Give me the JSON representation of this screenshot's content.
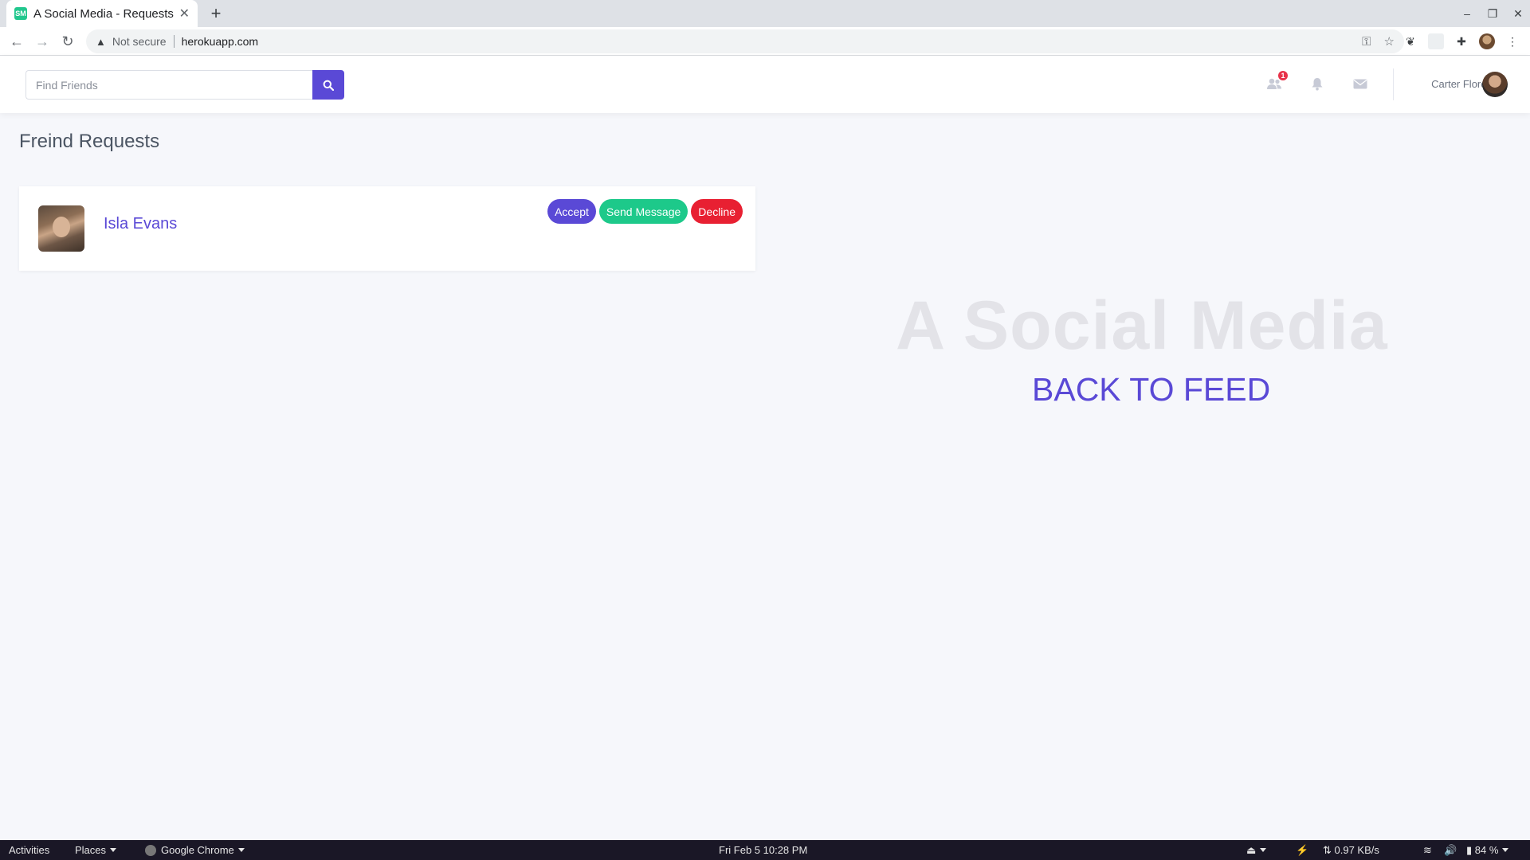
{
  "browser": {
    "tab_title": "A Social Media - Requests",
    "tab_favicon_text": "SM",
    "not_secure": "Not secure",
    "url": "herokuapp.com"
  },
  "header": {
    "search_placeholder": "Find Friends",
    "friend_requests_badge": "1",
    "user_name": "Carter Flores"
  },
  "page": {
    "title": "Freind Requests",
    "requests": [
      {
        "name": "Isla Evans",
        "accept_label": "Accept",
        "message_label": "Send Message",
        "decline_label": "Decline"
      }
    ],
    "brand": "A Social Media",
    "back_link": "BACK TO FEED"
  },
  "taskbar": {
    "activities": "Activities",
    "places": "Places",
    "app": "Google Chrome",
    "datetime": "Fri Feb 5  10:28 PM",
    "network": "⇅ 0.97 KB/s",
    "battery": "84 %"
  },
  "colors": {
    "accent": "#5a49d6",
    "success": "#1dc98a",
    "danger": "#e82032"
  }
}
